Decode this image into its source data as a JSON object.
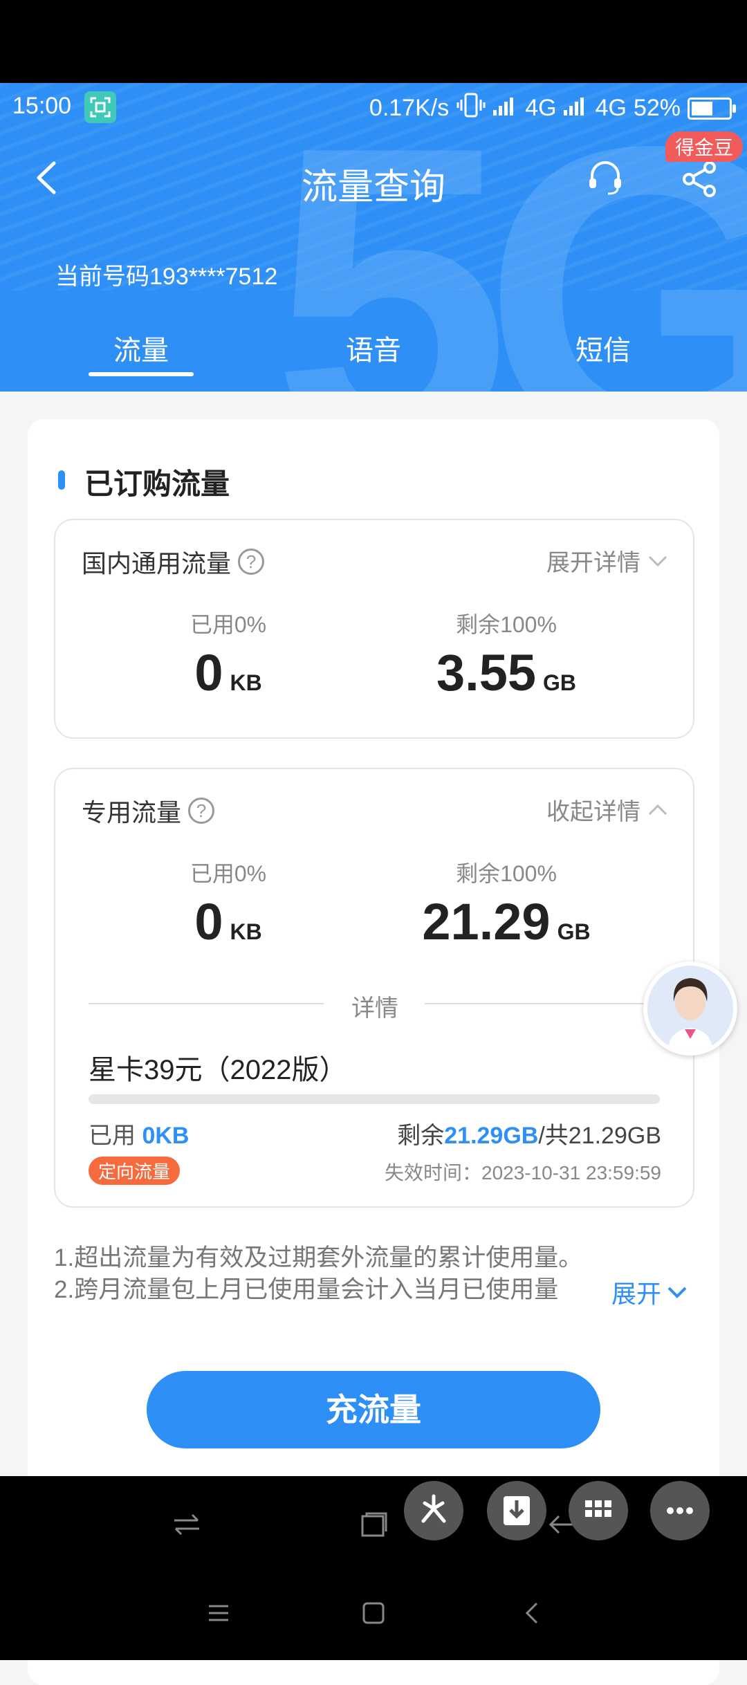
{
  "status_bar": {
    "time": "15:00",
    "speed": "0.17K/s",
    "net1": "4G",
    "net2": "4G",
    "battery": "52%"
  },
  "header": {
    "title": "流量查询",
    "badge": "得金豆",
    "phone_number": "当前号码193****7512",
    "tabs": [
      "流量",
      "语音",
      "短信"
    ],
    "active_tab": 0
  },
  "section": {
    "title": "已订购流量"
  },
  "domestic": {
    "title": "国内通用流量",
    "toggle": "展开详情",
    "used_label": "已用0%",
    "used_value": "0",
    "used_unit": "KB",
    "remain_label": "剩余100%",
    "remain_value": "3.55",
    "remain_unit": "GB"
  },
  "dedicated": {
    "title": "专用流量",
    "toggle": "收起详情",
    "used_label": "已用0%",
    "used_value": "0",
    "used_unit": "KB",
    "remain_label": "剩余100%",
    "remain_value": "21.29",
    "remain_unit": "GB",
    "detail_label": "详情",
    "plan": {
      "name": "星卡39元（2022版）",
      "used_prefix": "已用 ",
      "used_amount": "0KB",
      "remain_prefix": "剩余",
      "remain_amount": "21.29GB",
      "total_text": "/共21.29GB",
      "tag": "定向流量",
      "expire": "失效时间：2023-10-31 23:59:59",
      "used_fraction": 0
    }
  },
  "notes": {
    "line1": "1.超出流量为有效及过期套外流量的累计使用量。",
    "line2": "2.跨月流量包上月已使用量会计入当月已使用量",
    "expand": "展开"
  },
  "cta": {
    "label": "充流量"
  },
  "colors": {
    "primary": "#2e90f6",
    "tag": "#f56b3d",
    "badge": "#f35a5a"
  }
}
